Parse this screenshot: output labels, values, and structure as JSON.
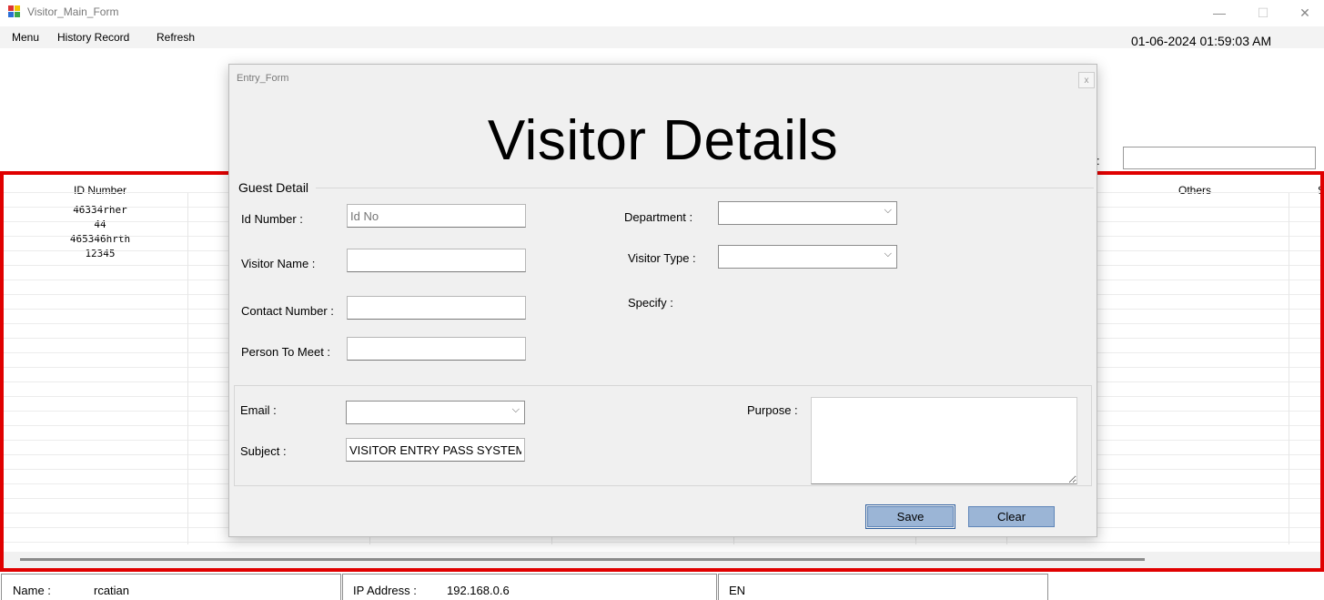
{
  "window": {
    "title": "Visitor_Main_Form",
    "minimize_glyph": "—",
    "maximize_glyph": "☐",
    "close_glyph": "✕"
  },
  "menu": {
    "items": [
      "Menu",
      "History Record",
      "Refresh"
    ]
  },
  "clock": "01-06-2024 01:59:03 AM",
  "search": {
    "label": ":",
    "value": ""
  },
  "grid": {
    "columns": [
      "ID Number",
      "Others",
      "S"
    ],
    "rows": [
      {
        "id": "46334rher"
      },
      {
        "id": "44"
      },
      {
        "id": "465346hrth"
      },
      {
        "id": "12345"
      }
    ]
  },
  "status": {
    "name_label": "Name :",
    "name_value": "rcatian",
    "ip_label": "IP Address :",
    "ip_value": "192.168.0.6",
    "lang": "EN"
  },
  "dialog": {
    "title": "Entry_Form",
    "close_glyph": "x",
    "heading": "Visitor Details",
    "group_label": "Guest Detail",
    "fields": {
      "id_number": {
        "label": "Id Number :",
        "placeholder": "Id No",
        "value": ""
      },
      "visitor_name": {
        "label": "Visitor Name :",
        "value": ""
      },
      "contact_number": {
        "label": "Contact Number :",
        "value": ""
      },
      "person_to_meet": {
        "label": "Person To Meet :",
        "value": ""
      },
      "department": {
        "label": "Department :",
        "value": ""
      },
      "visitor_type": {
        "label": "Visitor Type :",
        "value": ""
      },
      "specify": {
        "label": "Specify :"
      },
      "email": {
        "label": "Email :",
        "value": ""
      },
      "subject": {
        "label": "Subject :",
        "value": "VISITOR ENTRY PASS SYSTEM"
      },
      "purpose": {
        "label": "Purpose :",
        "value": ""
      }
    },
    "buttons": {
      "save": "Save",
      "clear": "Clear"
    },
    "chevron_glyph": "⌵"
  },
  "colors": {
    "grid_border": "#e00000",
    "button_fill": "#9bb5d6",
    "button_border": "#5e85b8"
  }
}
